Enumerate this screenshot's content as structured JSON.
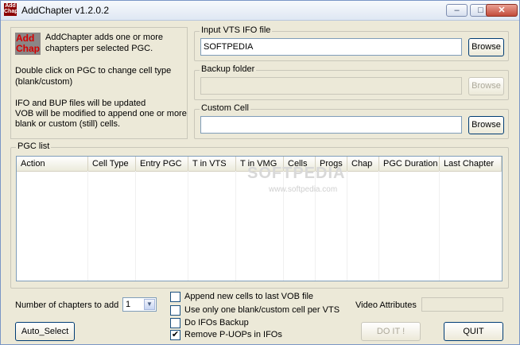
{
  "window": {
    "title": "AddChapter v1.2.0.2",
    "icon_text": "Add Chap",
    "minimize_glyph": "–",
    "maximize_glyph": "□",
    "close_glyph": "✕"
  },
  "info": {
    "logo_text": "Add Chap",
    "line1": "AddChapter adds one or more",
    "line2": "chapters per selected PGC.",
    "line3": "Double click on PGC to change cell type",
    "line4": "(blank/custom)",
    "line5": "IFO and BUP files will be updated",
    "line6": "VOB will be modified to append one or more",
    "line7": "blank or custom (still) cells."
  },
  "input_vts": {
    "label": "Input VTS IFO file",
    "value": "SOFTPEDIA",
    "browse": "Browse"
  },
  "backup": {
    "label": "Backup folder",
    "value": "",
    "browse": "Browse"
  },
  "custom_cell": {
    "label": "Custom Cell",
    "value": "",
    "browse": "Browse"
  },
  "pgc_list": {
    "label": "PGC list",
    "columns": [
      "Action",
      "Cell Type",
      "Entry PGC",
      "T in VTS",
      "T in VMG",
      "Cells",
      "Progs",
      "Chap",
      "PGC Duration",
      "Last Chapter"
    ],
    "watermark": "SOFTPEDIA",
    "watermark_sub": "www.softpedia.com"
  },
  "bottom": {
    "chapters_label": "Number of chapters to add",
    "chapters_value": "1",
    "cb1": "Append new cells to last VOB file",
    "cb2": "Use only one blank/custom cell per VTS",
    "cb3": "Do IFOs Backup",
    "cb4": "Remove P-UOPs in IFOs",
    "cb1_checked": false,
    "cb2_checked": false,
    "cb3_checked": false,
    "cb4_checked": true,
    "check_glyph": "✔",
    "video_attr_label": "Video Attributes",
    "video_attr_value": "",
    "auto_select": "Auto_Select",
    "do_it": "DO IT !",
    "quit": "QUIT"
  }
}
